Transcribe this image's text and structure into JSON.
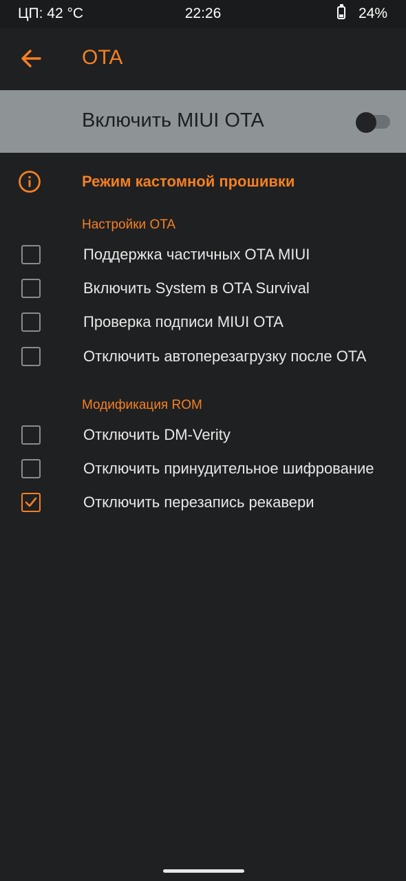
{
  "status_bar": {
    "cpu_temp": "ЦП: 42 °C",
    "time": "22:26",
    "battery": "24%"
  },
  "app_bar": {
    "title": "OTA",
    "back_icon": "arrow-left-icon"
  },
  "master_switch": {
    "label": "Включить MIUI OTA",
    "enabled": false
  },
  "custom_mode": {
    "icon": "info-icon",
    "label": "Режим кастомной прошивки"
  },
  "sections": [
    {
      "header": "Настройки OTA",
      "items": [
        {
          "label": "Поддержка частичных OTA MIUI",
          "checked": false
        },
        {
          "label": "Включить System в OTA Survival",
          "checked": false
        },
        {
          "label": "Проверка подписи MIUI OTA",
          "checked": false
        },
        {
          "label": "Отключить автоперезагрузку после OTA",
          "checked": false
        }
      ]
    },
    {
      "header": "Модификация ROM",
      "items": [
        {
          "label": "Отключить DM-Verity",
          "checked": false
        },
        {
          "label": "Отключить принудительное шифрование",
          "checked": false
        },
        {
          "label": "Отключить перезапись рекавери",
          "checked": true
        }
      ]
    }
  ],
  "colors": {
    "accent": "#f58021",
    "background": "#1f2022",
    "master_bar": "#8e9396"
  }
}
